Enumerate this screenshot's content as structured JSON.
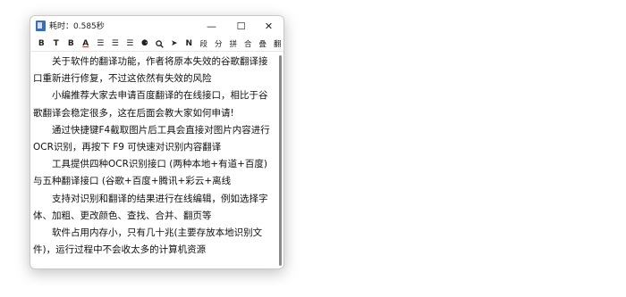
{
  "window": {
    "title": "耗时：0.585秒",
    "minimize": "—",
    "maximize": "☐",
    "close": "✕"
  },
  "toolbar": [
    {
      "name": "bold-icon",
      "label": "B"
    },
    {
      "name": "italic-icon",
      "label": "T"
    },
    {
      "name": "bold-toggle-icon",
      "label": "B"
    },
    {
      "name": "font-color-icon",
      "label": "A"
    },
    {
      "name": "align-left-icon",
      "label": "☰"
    },
    {
      "name": "align-center-icon",
      "label": "☰"
    },
    {
      "name": "align-right-icon",
      "label": "☰"
    },
    {
      "name": "paint-bucket-icon",
      "label": "⚈"
    },
    {
      "name": "search-icon",
      "label": "🔍"
    },
    {
      "name": "send-icon",
      "label": "➤"
    },
    {
      "name": "n-icon",
      "label": "N"
    },
    {
      "name": "tool-duan",
      "label": "段"
    },
    {
      "name": "tool-fen",
      "label": "分"
    },
    {
      "name": "tool-pin",
      "label": "拼"
    },
    {
      "name": "tool-he",
      "label": "合"
    },
    {
      "name": "tool-die",
      "label": "叠"
    },
    {
      "name": "tool-fan",
      "label": "翻"
    }
  ],
  "content": {
    "paragraphs": [
      "关于软件的翻译功能，作者将原本失效的谷歌翻译接口重新进行修复，不过这依然有失效的风险",
      "小编推荐大家去申请百度翻译的在线接口，相比于谷歌翻译会稳定很多，这在后面会教大家如何申请!",
      "通过快捷键F4截取图片后工具会直接对图片内容进行OCR识别，再按下 F9 可快速对识别内容翻译",
      "工具提供四种OCR识别接口 (两种本地+有道+百度) 与五种翻译接口 (谷歌+百度+腾讯+彩云+离线",
      "支持对识别和翻译的结果进行在线编辑，例如选择字体、加粗、更改颜色、查找、合并、翻页等",
      "软件占用内存小，只有几十兆(主要存放本地识别文件)，运行过程中不会收太多的计算机资源"
    ]
  }
}
